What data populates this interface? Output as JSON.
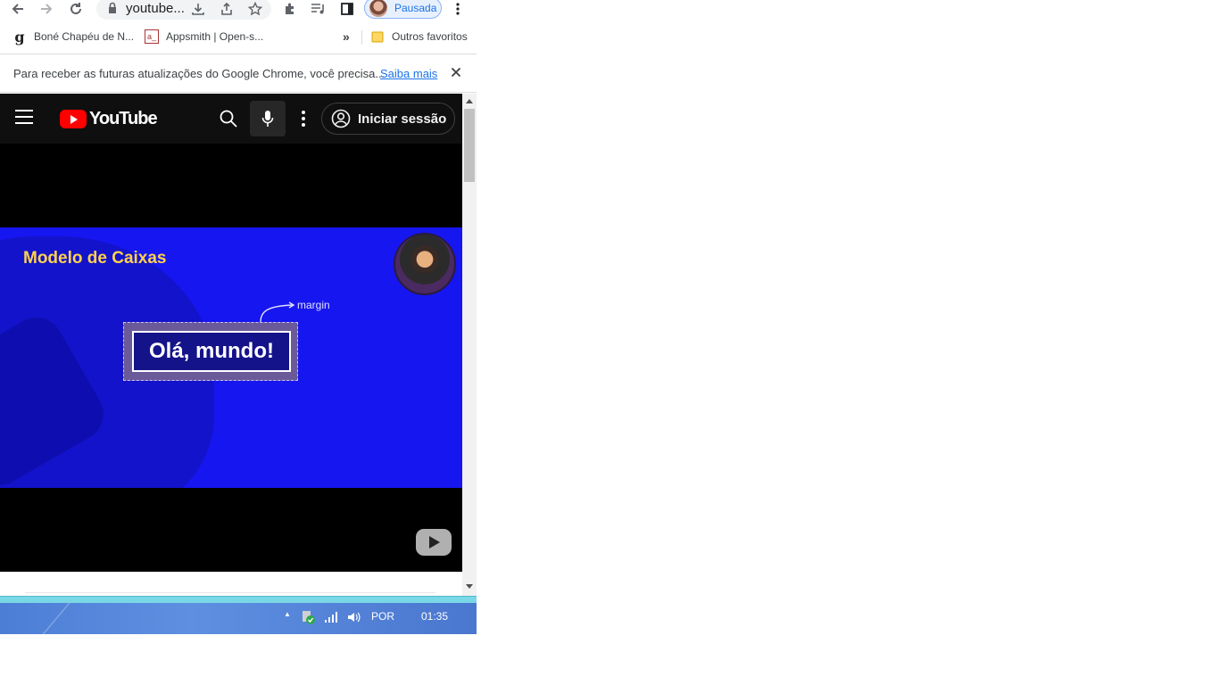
{
  "browser": {
    "url": "youtube...",
    "profile_label": "Pausada"
  },
  "bookmarks": {
    "items": [
      {
        "label": "Boné Chapéu de N..."
      },
      {
        "label": "Appsmith | Open-s..."
      }
    ],
    "overflow_label": "»",
    "other_label": "Outros favoritos"
  },
  "infobar": {
    "message": "Para receber as futuras atualizações do Google Chrome, você precisa...",
    "link": "Saiba mais",
    "close": "✕"
  },
  "youtube": {
    "logo_text": "YouTube",
    "signin_label": "Iniciar sessão"
  },
  "video": {
    "title": "Modelo de Caixas",
    "annotation": "margin",
    "box_text": "Olá, mundo!"
  },
  "taskbar": {
    "language": "POR",
    "time": "01:35",
    "tray_arrow": "▲"
  },
  "colors": {
    "video_bg": "#1616f0",
    "title_yellow": "#ffd24d",
    "yt_red": "#ff0000",
    "link_blue": "#1a73e8"
  }
}
